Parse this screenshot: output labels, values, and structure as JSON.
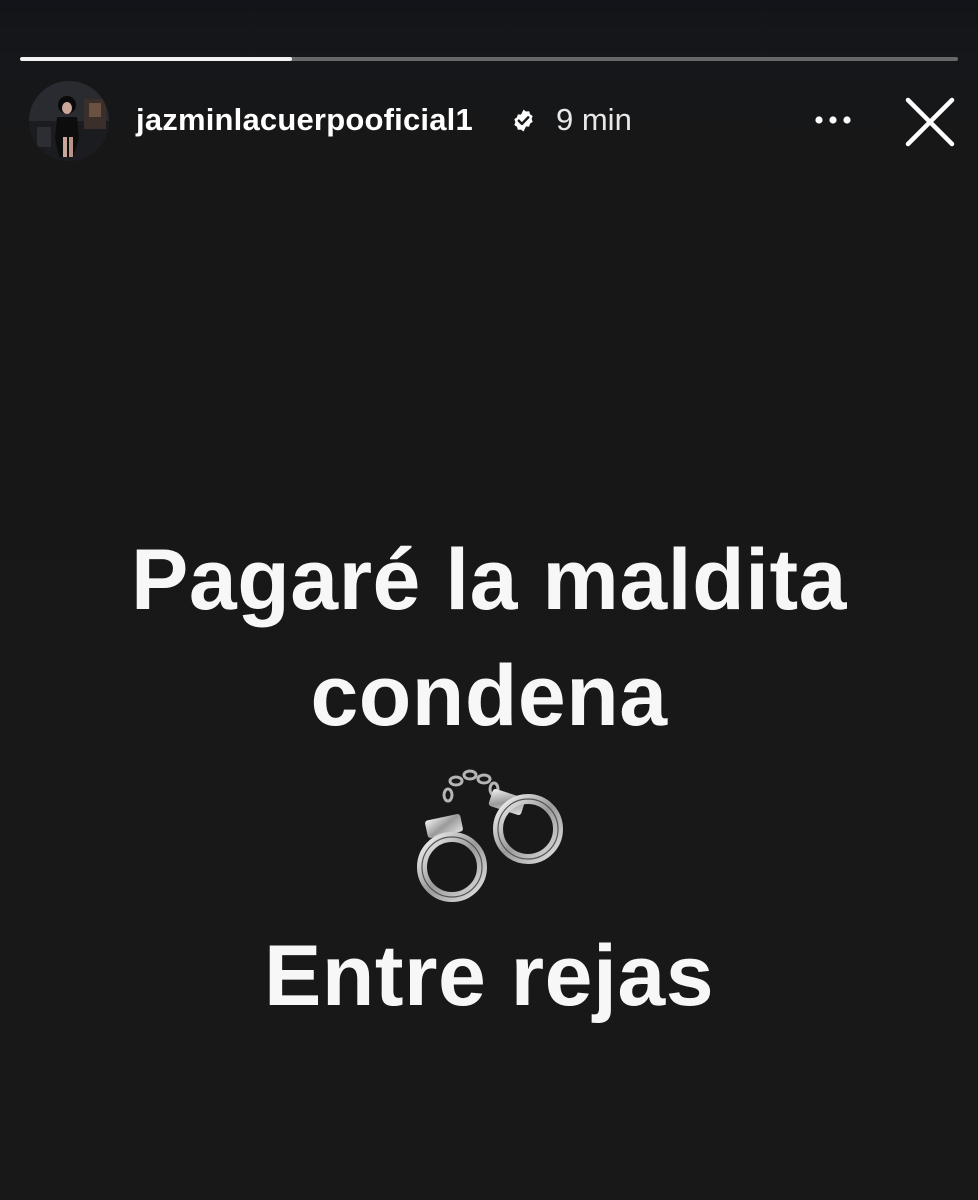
{
  "progress": {
    "fraction": 0.29
  },
  "header": {
    "username": "jazminlacuerpooficial1",
    "verified": true,
    "timestamp": "9 min",
    "more_icon": "more-horizontal-icon",
    "close_icon": "close-icon"
  },
  "story": {
    "line1": "Pagaré la maldita",
    "line2": "condena",
    "emoji": "handcuffs-icon",
    "line3": "Entre rejas"
  },
  "colors": {
    "background": "#181818",
    "text": "#ffffff",
    "progress_fill": "#f2f2f2"
  }
}
